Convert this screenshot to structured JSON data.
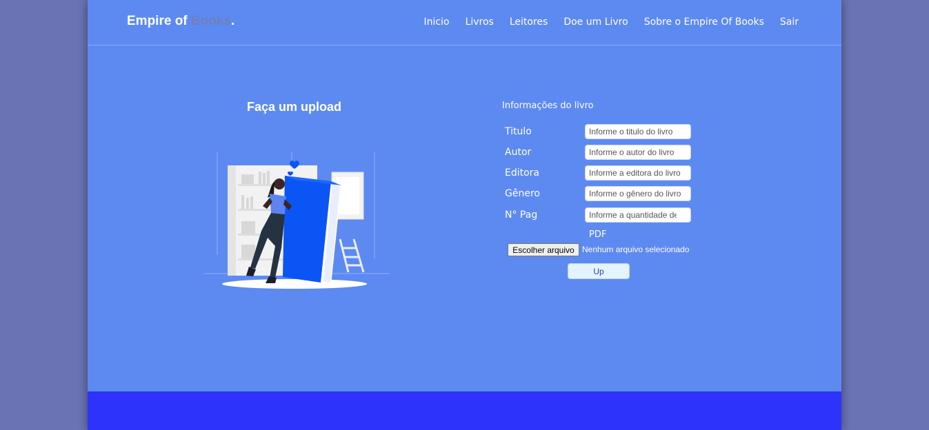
{
  "brand": {
    "prefix": "Empire of ",
    "accent": "Books",
    "suffix": "."
  },
  "nav": [
    {
      "label": "Inicio"
    },
    {
      "label": "Livros"
    },
    {
      "label": "Leitores"
    },
    {
      "label": "Doe um Livro"
    },
    {
      "label": "Sobre o Empire Of Books"
    },
    {
      "label": "Sair"
    }
  ],
  "upload": {
    "title": "Faça um upload",
    "illustration": "woman-leaning-on-book-illustration"
  },
  "form": {
    "title": "Informações do livro",
    "fields": [
      {
        "label": "Titulo",
        "placeholder": "Informe o titulo do livro",
        "value": ""
      },
      {
        "label": "Autor",
        "placeholder": "Informe o autor do livro",
        "value": ""
      },
      {
        "label": "Editora",
        "placeholder": "Informe a editora do livro",
        "value": ""
      },
      {
        "label": "Gênero",
        "placeholder": "Informe o gênero do livro",
        "value": ""
      },
      {
        "label": "N° Pag",
        "placeholder": "Informe a quantidade de",
        "value": ""
      }
    ],
    "pdf_label": "PDF",
    "file_button": "Escolher arquivo",
    "file_status": "Nenhum arquivo selecionado",
    "submit": "Up"
  },
  "colors": {
    "outer_background": "#6a73b3",
    "page_background": "#5d8af1",
    "brand_accent": "#6f7fb9",
    "footer": "#2e33fb",
    "button_background": "#e3f4ff",
    "book_blue": "#0b55f5"
  }
}
